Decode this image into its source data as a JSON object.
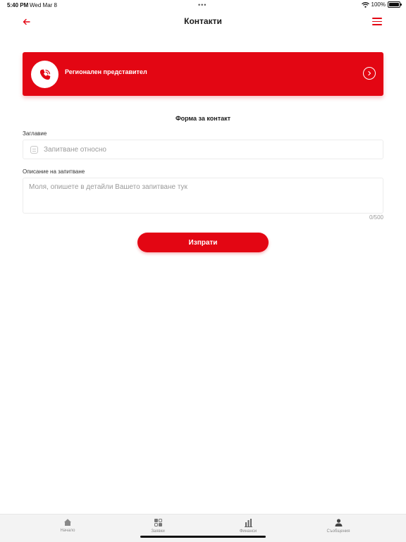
{
  "status_bar": {
    "time": "5:40 PM",
    "date": "Wed Mar 8",
    "battery": "100%"
  },
  "header": {
    "title": "Контакти"
  },
  "regional_rep": {
    "label": "Регионален представител"
  },
  "form": {
    "title": "Форма за контакт",
    "subject_label": "Заглавие",
    "subject_placeholder": "Запитване относно",
    "description_label": "Описание на запитване",
    "description_placeholder": "Моля, опишете в детайли Вашето запитване тук",
    "char_counter": "0/500",
    "submit_label": "Изпрати"
  },
  "tab_bar": {
    "items": [
      {
        "label": "Начало",
        "icon": "home-icon"
      },
      {
        "label": "Заявки",
        "icon": "requests-icon"
      },
      {
        "label": "Финанси",
        "icon": "finance-icon"
      },
      {
        "label": "Съобщения",
        "icon": "messages-icon"
      }
    ]
  },
  "colors": {
    "accent": "#e30613",
    "tab_icon": "#777777",
    "placeholder": "#9a9a9a"
  }
}
